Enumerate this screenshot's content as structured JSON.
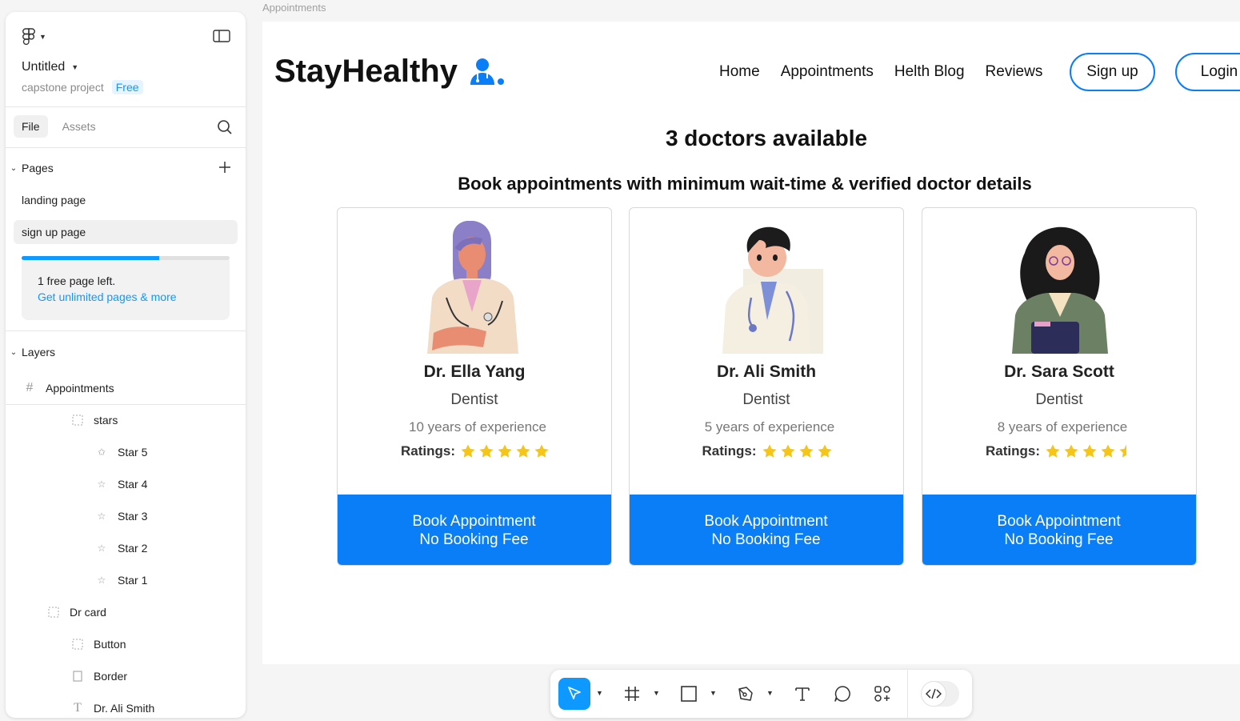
{
  "panel": {
    "file_title": "Untitled",
    "project": "capstone project",
    "plan": "Free",
    "tabs": {
      "file": "File",
      "assets": "Assets"
    },
    "pages": {
      "header": "Pages",
      "items": [
        "landing page",
        "sign up page"
      ],
      "selected": "sign up page"
    },
    "upsell": {
      "progress_fraction": 0.66,
      "message": "1 free page left.",
      "link": "Get unlimited pages & more"
    },
    "layers": {
      "header": "Layers",
      "items": [
        {
          "label": "Appointments",
          "icon": "frame-icon"
        },
        {
          "label": "stars",
          "icon": "group-icon"
        },
        {
          "label": "Star 5",
          "icon": "half-star-icon"
        },
        {
          "label": "Star 4",
          "icon": "star-outline-icon"
        },
        {
          "label": "Star 3",
          "icon": "star-outline-icon"
        },
        {
          "label": "Star 2",
          "icon": "star-outline-icon"
        },
        {
          "label": "Star 1",
          "icon": "star-outline-icon"
        },
        {
          "label": "Dr card",
          "icon": "group-icon"
        },
        {
          "label": "Button",
          "icon": "group-icon"
        },
        {
          "label": "Border",
          "icon": "rectangle-icon"
        },
        {
          "label": "Dr. Ali Smith",
          "icon": "text-icon"
        }
      ]
    }
  },
  "canvas": {
    "frame_label": "Appointments",
    "brand": "StayHealthy",
    "nav": {
      "links": [
        "Home",
        "Appointments",
        "Helth Blog",
        "Reviews"
      ],
      "signup": "Sign up",
      "login": "Login"
    },
    "heading": "3 doctors available",
    "subheading": "Book appointments with minimum wait-time & verified doctor details",
    "doctors": [
      {
        "name": "Dr. Ella Yang",
        "specialty": "Dentist",
        "experience": "10 years of experience",
        "ratings_label": "Ratings:",
        "stars": 5,
        "book_line1": "Book Appointment",
        "book_line2": "No Booking Fee"
      },
      {
        "name": "Dr. Ali Smith",
        "specialty": "Dentist",
        "experience": "5 years of experience",
        "ratings_label": "Ratings:",
        "stars": 4,
        "book_line1": "Book Appointment",
        "book_line2": "No Booking Fee"
      },
      {
        "name": "Dr. Sara Scott",
        "specialty": "Dentist",
        "experience": "8 years of experience",
        "ratings_label": "Ratings:",
        "stars": 4.5,
        "book_line1": "Book Appointment",
        "book_line2": "No Booking Fee"
      }
    ]
  },
  "toolbar": {
    "tools": [
      "move-tool-icon",
      "frame-tool-icon",
      "rectangle-tool-icon",
      "pen-tool-icon",
      "text-tool-icon",
      "comment-tool-icon",
      "actions-icon",
      "dev-mode-icon"
    ]
  },
  "colors": {
    "accent": "#0d99ff",
    "brand_blue": "#0a7ef7",
    "star": "#f5c518"
  }
}
